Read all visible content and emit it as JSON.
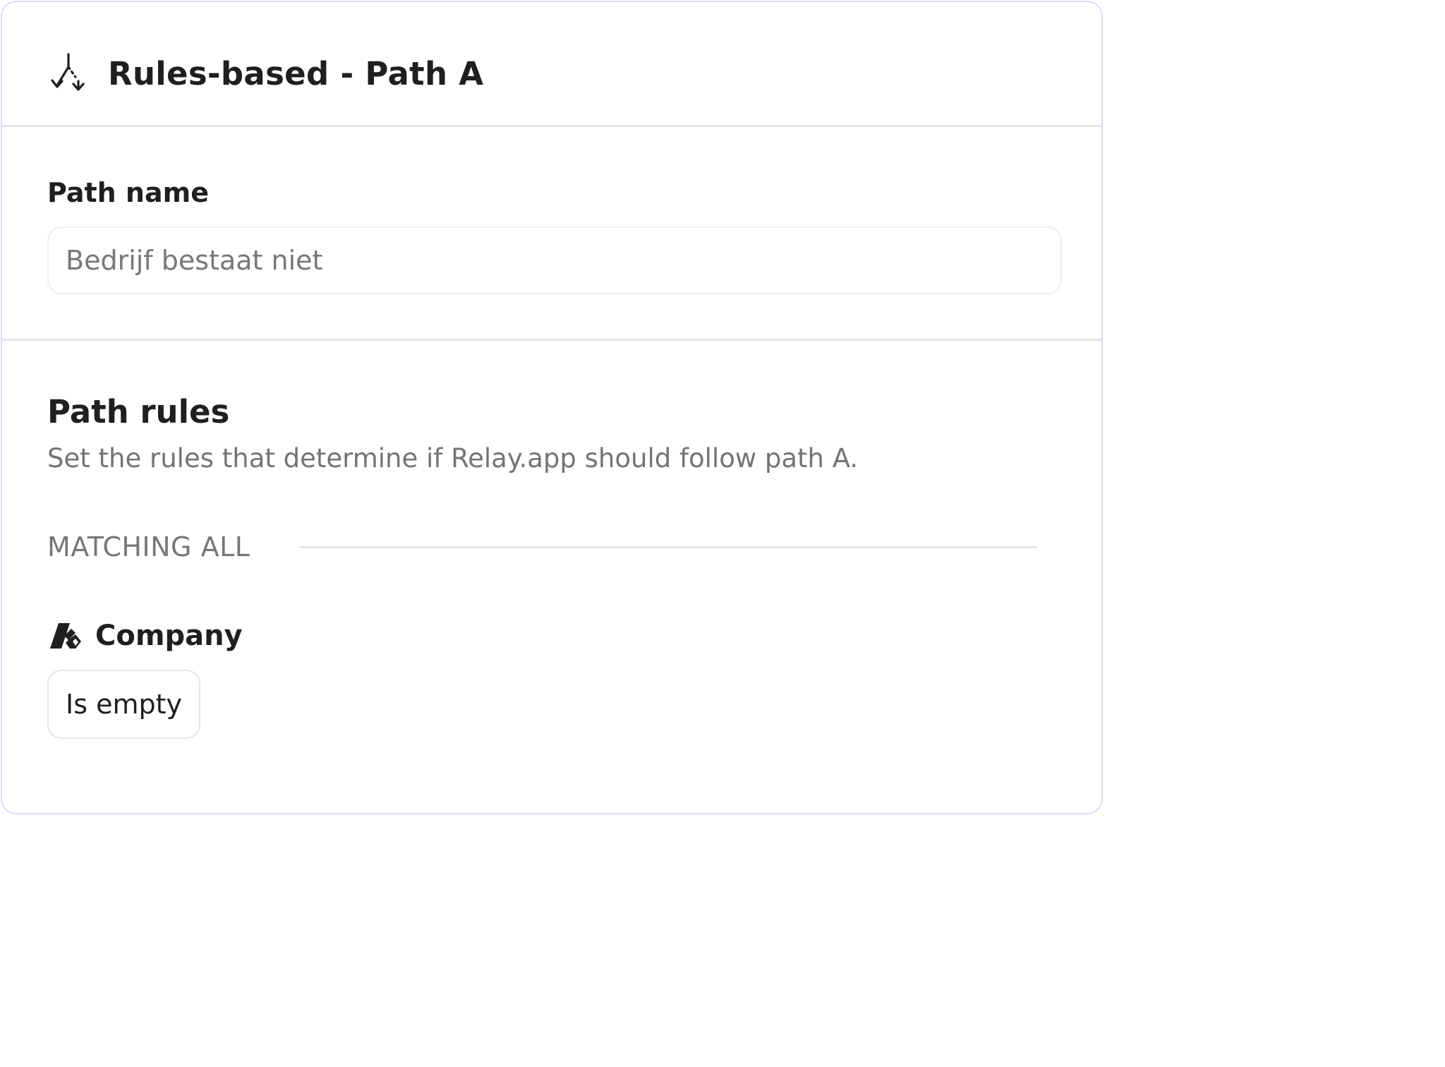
{
  "header": {
    "icon": "split-path-icon",
    "title": "Rules-based - Path A"
  },
  "path_name": {
    "label": "Path name",
    "value": "",
    "placeholder": "Bedrijf bestaat niet"
  },
  "path_rules": {
    "title": "Path rules",
    "description": "Set the rules that determine if Relay.app should follow path A.",
    "matching_label": "MATCHING ALL",
    "rules": [
      {
        "icon": "hubspot-company-icon",
        "field": "Company",
        "condition": "Is empty"
      }
    ]
  },
  "colors": {
    "panel_border": "#d9ddf7",
    "divider": "#e6e6e6",
    "muted_text": "#777777",
    "text": "#1f1f1f"
  }
}
